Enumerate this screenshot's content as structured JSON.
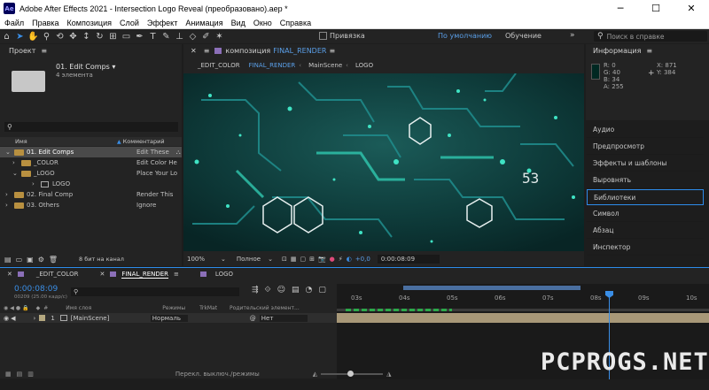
{
  "titlebar": {
    "app_abbr": "Ae",
    "title": "Adobe After Effects 2021 - Intersection Logo Reveal (преобразовано).aep *"
  },
  "menu": [
    "Файл",
    "Правка",
    "Композиция",
    "Слой",
    "Эффект",
    "Анимация",
    "Вид",
    "Окно",
    "Справка"
  ],
  "toolbar": {
    "snap_label": "Привязка",
    "workspace_default": "По умолчанию",
    "workspace_learn": "Обучение",
    "help_search_placeholder": "Поиск в справке"
  },
  "project": {
    "title": "Проект",
    "selected_name": "01. Edit Comps",
    "selected_count": "4 элемента",
    "col_name": "Имя",
    "col_comment": "Комментарий",
    "items": [
      {
        "name": "01. Edit Comps",
        "comment": "Edit These"
      },
      {
        "name": "_COLOR",
        "comment": "Edit Color He"
      },
      {
        "name": "_LOGO",
        "comment": "Place Your Lo"
      },
      {
        "name": "LOGO",
        "comment": ""
      },
      {
        "name": "02. Final Comp",
        "comment": "Render This"
      },
      {
        "name": "03. Others",
        "comment": "Ignore"
      }
    ],
    "bit_depth": "8 бит на канал"
  },
  "comp": {
    "title": "композиция",
    "name": "FINAL_RENDER",
    "crumbs": [
      "_EDIT_COLOR",
      "FINAL_RENDER",
      "MainScene",
      "LOGO"
    ],
    "zoom": "100%",
    "quality": "Полное",
    "exposure": "+0,0",
    "timecode": "0:00:08:09"
  },
  "info": {
    "title": "Информация",
    "r": "0",
    "g": "40",
    "b": "34",
    "a": "255",
    "x": "871",
    "y": "384",
    "color_hex": "#002822"
  },
  "side_panels": [
    "Аудио",
    "Предпросмотр",
    "Эффекты и шаблоны",
    "Выровнять",
    "Библиотеки",
    "Символ",
    "Абзац",
    "Инспектор"
  ],
  "timeline": {
    "tabs": [
      "_EDIT_COLOR",
      "FINAL_RENDER",
      "LOGO"
    ],
    "timecode": "0:00:08:09",
    "frames": "00209 (25.00 кадр/с)",
    "col_layer": "Имя слоя",
    "col_modes": "Режимы",
    "col_trkmat": "TrkMat",
    "col_parent": "Родительский элемент...",
    "layer": {
      "index": "1",
      "name": "[MainScene]",
      "mode": "Нормаль",
      "parent": "Нет"
    },
    "ticks": [
      "03s",
      "04s",
      "05s",
      "06s",
      "07s",
      "08s",
      "09s",
      "10s"
    ],
    "footer_label": "Перекл. выключ./режимы"
  },
  "watermark": "PCPROGS.NET",
  "viewer_overlay_number": "53"
}
